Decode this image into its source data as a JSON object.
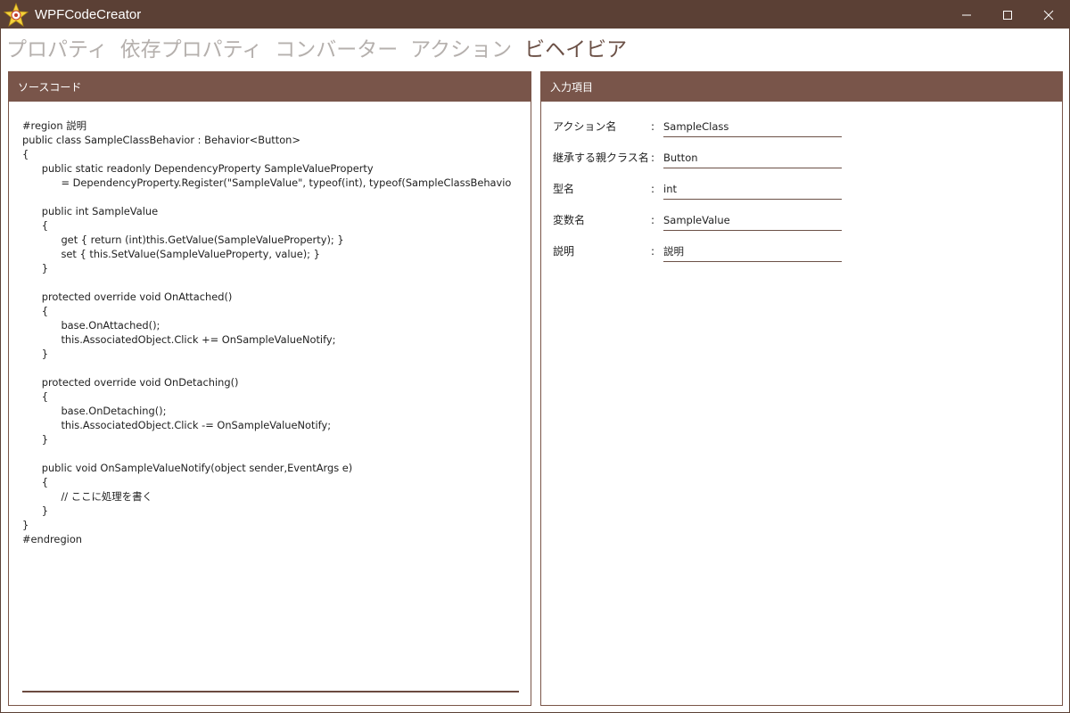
{
  "app": {
    "title": "WPFCodeCreator"
  },
  "window_controls": {
    "minimize_icon": "minimize-icon",
    "maximize_icon": "maximize-icon",
    "close_icon": "close-icon"
  },
  "tabs": [
    {
      "label": "プロパティ",
      "active": false
    },
    {
      "label": "依存プロパティ",
      "active": false
    },
    {
      "label": "コンバーター",
      "active": false
    },
    {
      "label": "アクション",
      "active": false
    },
    {
      "label": "ビヘイビア",
      "active": true
    }
  ],
  "source_panel": {
    "header": "ソースコード",
    "lines": [
      "#region 説明",
      "public class SampleClassBehavior : Behavior<Button>",
      "{",
      "\t\tpublic static readonly DependencyProperty SampleValueProperty",
      "\t\t\t\t= DependencyProperty.Register(\"SampleValue\", typeof(int), typeof(SampleClassBehavio",
      "",
      "\t\tpublic int SampleValue",
      "\t\t{",
      "\t\t\t\tget { return (int)this.GetValue(SampleValueProperty); }",
      "\t\t\t\tset { this.SetValue(SampleValueProperty, value); }",
      "\t\t}",
      "",
      "\t\tprotected override void OnAttached()",
      "\t\t{",
      "\t\t\t\tbase.OnAttached();",
      "\t\t\t\tthis.AssociatedObject.Click += OnSampleValueNotify;",
      "\t\t}",
      "",
      "\t\tprotected override void OnDetaching()",
      "\t\t{",
      "\t\t\t\tbase.OnDetaching();",
      "\t\t\t\tthis.AssociatedObject.Click -= OnSampleValueNotify;",
      "\t\t}",
      "",
      "\t\tpublic void OnSampleValueNotify(object sender,EventArgs e)",
      "\t\t{",
      "\t\t\t\t// ここに処理を書く",
      "\t\t}",
      "}",
      "#endregion"
    ]
  },
  "input_panel": {
    "header": "入力項目",
    "fields": [
      {
        "label": "アクション名",
        "colon": ":",
        "value": "SampleClass"
      },
      {
        "label": "継承する親クラス名",
        "colon": ":",
        "value": "Button"
      },
      {
        "label": "型名",
        "colon": ":",
        "value": "int"
      },
      {
        "label": "変数名",
        "colon": ":",
        "value": "SampleValue"
      },
      {
        "label": "説明",
        "colon": ":",
        "value": "説明"
      }
    ]
  },
  "colors": {
    "titlebar": "#5b4035",
    "panel_header": "#79554a",
    "tab_active": "#6b5046",
    "tab_inactive": "#b5b0ad"
  }
}
